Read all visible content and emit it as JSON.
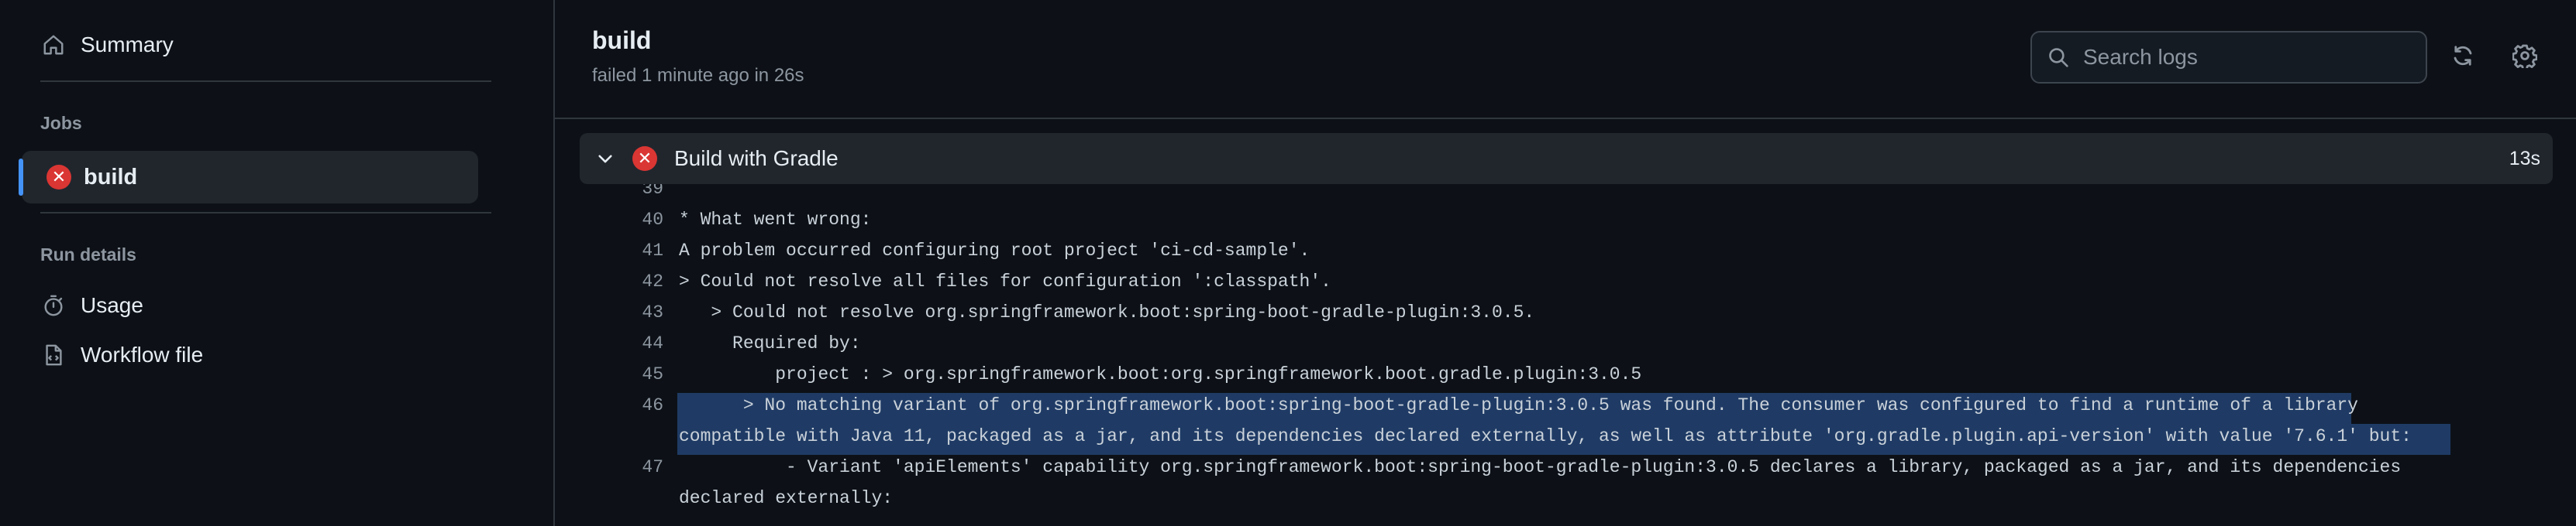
{
  "sidebar": {
    "summary_label": "Summary",
    "jobs_heading": "Jobs",
    "job_label": "build",
    "run_details_heading": "Run details",
    "usage_label": "Usage",
    "workflow_label": "Workflow file"
  },
  "header": {
    "title": "build",
    "subtitle": "failed 1 minute ago in 26s",
    "search_placeholder": "Search logs"
  },
  "step": {
    "name": "Build with Gradle",
    "duration": "13s"
  },
  "log": {
    "lines": [
      {
        "num": "39",
        "text": ""
      },
      {
        "num": "40",
        "text": "* What went wrong:"
      },
      {
        "num": "41",
        "text": "A problem occurred configuring root project 'ci-cd-sample'."
      },
      {
        "num": "42",
        "text": "> Could not resolve all files for configuration ':classpath'."
      },
      {
        "num": "43",
        "text": "   > Could not resolve org.springframework.boot:spring-boot-gradle-plugin:3.0.5."
      },
      {
        "num": "44",
        "text": "     Required by:"
      },
      {
        "num": "45",
        "text": "         project : > org.springframework.boot:org.springframework.boot.gradle.plugin:3.0.5"
      },
      {
        "num": "46",
        "text": "      > No matching variant of org.springframework.boot:spring-boot-gradle-plugin:3.0.5 was found. The consumer was configured to find a runtime of a library"
      },
      {
        "num": "",
        "text": "compatible with Java 11, packaged as a jar, and its dependencies declared externally, as well as attribute 'org.gradle.plugin.api-version' with value '7.6.1' but:"
      },
      {
        "num": "47",
        "text": "          - Variant 'apiElements' capability org.springframework.boot:spring-boot-gradle-plugin:3.0.5 declares a library, packaged as a jar, and its dependencies"
      },
      {
        "num": "",
        "text": "declared externally:"
      }
    ]
  },
  "colors": {
    "background": "#0d1117",
    "panel": "#21262d",
    "accent": "#4493f8",
    "fail": "#da3633",
    "selection": "#1f3b65"
  }
}
